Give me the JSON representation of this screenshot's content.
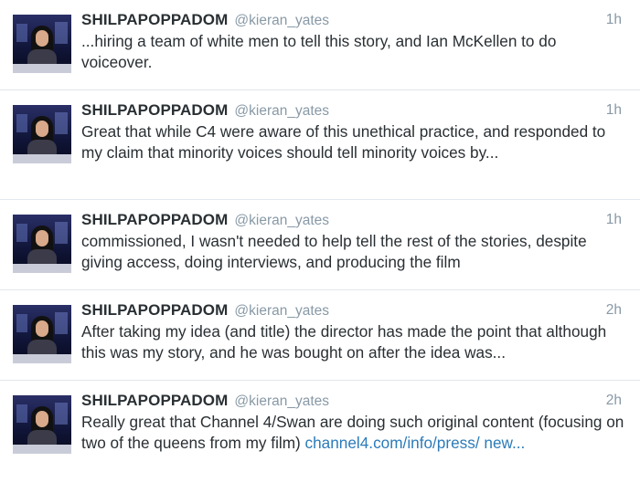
{
  "tweets": [
    {
      "name": "SHILPAPOPPADOM",
      "handle": "@kieran_yates",
      "time": "1h",
      "text": "...hiring a team of white men to tell this story, and Ian McKellen to do voiceover."
    },
    {
      "name": "SHILPAPOPPADOM",
      "handle": "@kieran_yates",
      "time": "1h",
      "text": "Great that while C4 were aware of this unethical practice, and responded to my claim that minority voices should tell minority voices by..."
    },
    {
      "name": "SHILPAPOPPADOM",
      "handle": "@kieran_yates",
      "time": "1h",
      "text": "commissioned, I wasn't needed to help tell the rest of the stories, despite giving access, doing interviews, and producing the film"
    },
    {
      "name": "SHILPAPOPPADOM",
      "handle": "@kieran_yates",
      "time": "2h",
      "text": "After taking my idea (and title) the director has made the point that although this was my story, and he was bought on after the idea was..."
    },
    {
      "name": "SHILPAPOPPADOM",
      "handle": "@kieran_yates",
      "time": "2h",
      "text": "Really great that Channel 4/Swan are doing such original content (focusing on two of the queens from my film) ",
      "link": "channel4.com/info/press/ new..."
    }
  ]
}
